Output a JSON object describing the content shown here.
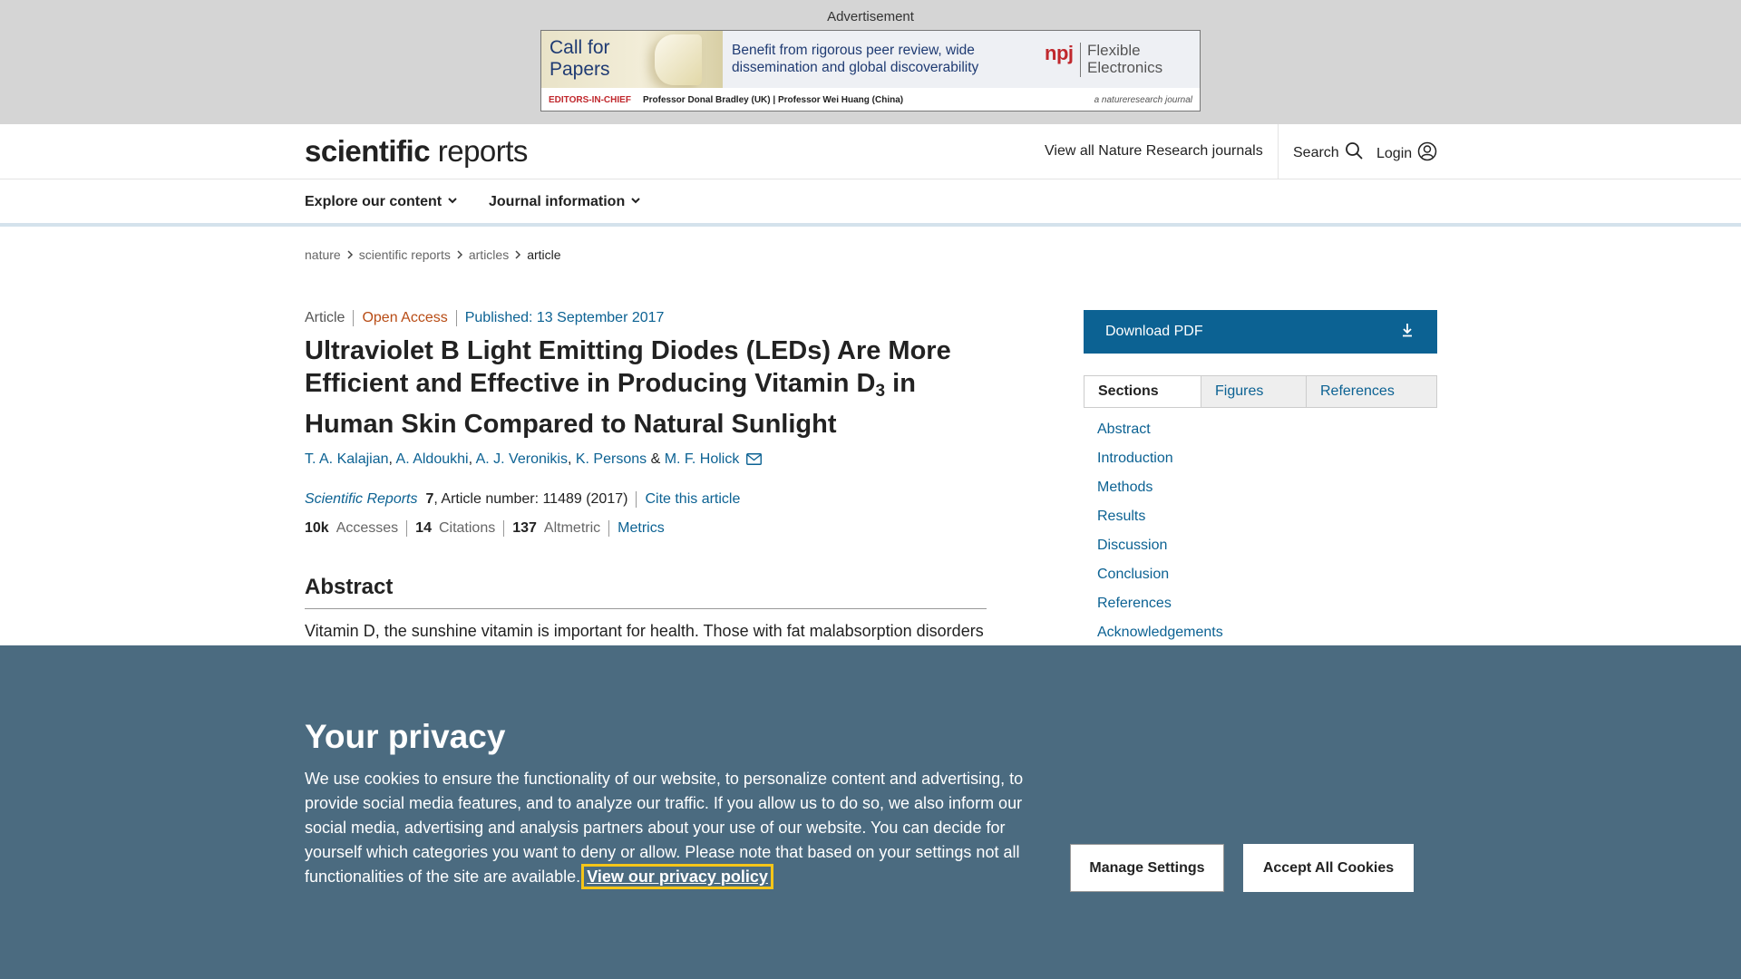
{
  "ad": {
    "label": "Advertisement",
    "cfp": "Call for Papers",
    "message": "Benefit from rigorous peer review, wide dissemination and global discoverability",
    "npj": "npj",
    "journal_name": "Flexible Electronics",
    "editors_label": "EDITORS-IN-CHIEF",
    "editors_names": "Professor Donal Bradley (UK)  |  Professor Wei Huang (China)",
    "brand": "a natureresearch journal"
  },
  "header": {
    "logo_bold": "scientific",
    "logo_light": " reports",
    "view_all": "View all Nature Research journals",
    "search": "Search",
    "login": "Login"
  },
  "subnav": {
    "explore": "Explore our content",
    "journal_info": "Journal information"
  },
  "breadcrumb": {
    "items": [
      "nature",
      "scientific reports",
      "articles",
      "article"
    ]
  },
  "article": {
    "type": "Article",
    "access": "Open Access",
    "published": "Published: 13 September 2017",
    "title_part1": "Ultraviolet B Light Emitting Diodes (LEDs) Are More Efficient and Effective in Producing Vitamin D",
    "title_sub": "3",
    "title_part2": " in Human Skin Compared to Natural Sunlight",
    "authors": [
      "T. A. Kalajian",
      "A. Aldoukhi",
      "A. J. Veronikis",
      "K. Persons",
      "M. F. Holick"
    ],
    "author_sep": ", ",
    "author_and": " & ",
    "journal": "Scientific Reports",
    "volume": "7",
    "article_number": ", Article number: 11489 (2017)",
    "cite": "Cite this article",
    "accesses_value": "10k",
    "accesses_label": "Accesses",
    "citations_value": "14",
    "citations_label": "Citations",
    "altmetric_value": "137",
    "altmetric_label": "Altmetric",
    "metrics_link": "Metrics",
    "abstract_heading": "Abstract",
    "abstract_text": "Vitamin D, the sunshine vitamin is important for health. Those with fat malabsorption disorders"
  },
  "sidebar": {
    "download": "Download PDF",
    "tabs": [
      "Sections",
      "Figures",
      "References"
    ],
    "sections": [
      "Abstract",
      "Introduction",
      "Methods",
      "Results",
      "Discussion",
      "Conclusion",
      "References",
      "Acknowledgements"
    ]
  },
  "cookie": {
    "title": "Your privacy",
    "text": "We use cookies to ensure the functionality of our website, to personalize content and advertising, to provide social media features, and to analyze our traffic. If you allow us to do so, we also inform our social media, advertising and analysis partners about your use of our website. You can decide for yourself which categories you want to deny or allow. Please note that based on your settings not all functionalities of the site are available. ",
    "policy_link": "View our privacy policy",
    "manage": "Manage Settings",
    "accept": "Accept All Cookies"
  },
  "colors": {
    "link": "#0c6293",
    "open_access": "#b84c15",
    "cookie_bg": "#4b6b80",
    "ad_bg": "#d5d5d5"
  }
}
